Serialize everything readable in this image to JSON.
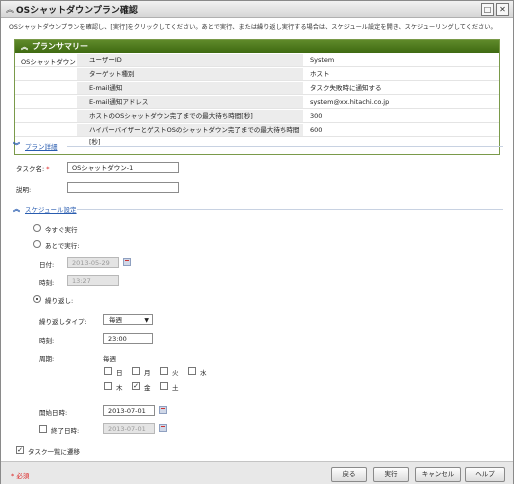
{
  "window": {
    "title": "OSシャットダウンプラン確認"
  },
  "description": "OSシャットダウンプランを確認し、[実行]をクリックしてください。あとで実行、または繰り返し実行する場合は、スケジュール設定を開き、スケジューリングしてください。",
  "summary": {
    "title": "プランサマリー",
    "group_label": "OSシャットダウン",
    "rows": [
      {
        "key": "ユーザーID",
        "value": "System"
      },
      {
        "key": "ターゲット種別",
        "value": "ホスト"
      },
      {
        "key": "E-mail通知",
        "value": "タスク失敗時に通知する"
      },
      {
        "key": "E-mail通知アドレス",
        "value": "system@xx.hitachi.co.jp"
      },
      {
        "key": "ホストのOSシャットダウン完了までの最大待ち時間[秒]",
        "value": "300"
      },
      {
        "key": "ハイパーバイザーとゲストOSのシャットダウン完了までの最大待ち時間[秒]",
        "value": "600"
      }
    ]
  },
  "plan_details": {
    "link": "プラン詳細",
    "task_name_label": "タスク名:",
    "required_mark": "*",
    "task_name_value": "OSシャットダウン-1",
    "description_label": "説明:",
    "description_value": ""
  },
  "schedule": {
    "link": "スケジュール設定",
    "run_now": "今すぐ実行",
    "run_later": "あとで実行:",
    "date_label": "日付:",
    "date_value": "2013-05-29",
    "time_label": "時刻:",
    "time_value": "13:27",
    "repeat": "繰り返し:",
    "repeat_type_label": "繰り返しタイプ:",
    "repeat_type_value": "毎週",
    "repeat_time_label": "時刻:",
    "repeat_time_value": "23:00",
    "period_label": "周期:",
    "period_value": "毎週",
    "days": [
      "日",
      "月",
      "火",
      "水",
      "木",
      "金",
      "土"
    ],
    "days_checked": [
      false,
      false,
      false,
      false,
      false,
      true,
      false
    ],
    "start_label": "開始日時:",
    "start_value": "2013-07-01",
    "end_label": "終了日時:",
    "end_value": "2013-07-01"
  },
  "goto_task_list": "タスク一覧に遷移",
  "footer": {
    "required_note": "必須",
    "required_mark": "*",
    "back": "戻る",
    "execute": "実行",
    "cancel": "キャンセル",
    "help": "ヘルプ"
  }
}
